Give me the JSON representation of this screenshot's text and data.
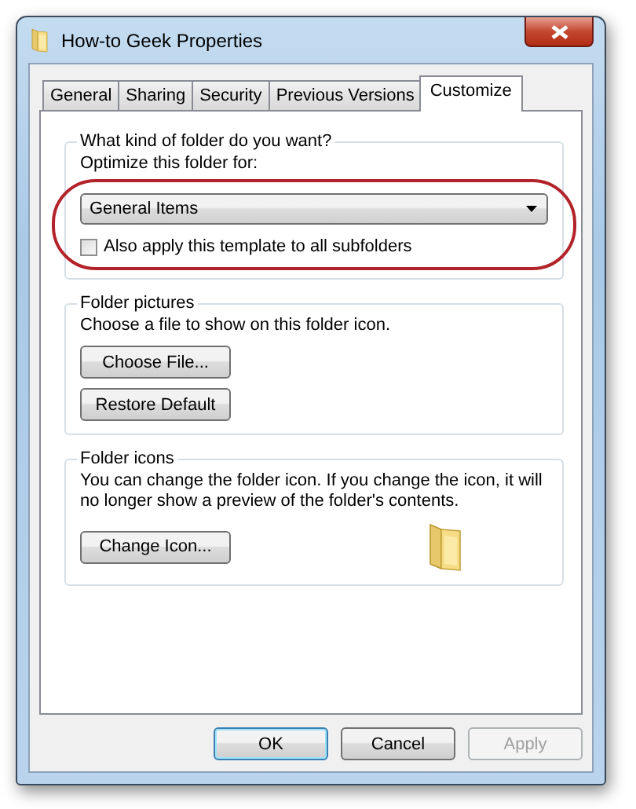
{
  "window": {
    "title": "How-to Geek Properties"
  },
  "tabs": [
    {
      "label": "General",
      "selected": false
    },
    {
      "label": "Sharing",
      "selected": false
    },
    {
      "label": "Security",
      "selected": false
    },
    {
      "label": "Previous Versions",
      "selected": false
    },
    {
      "label": "Customize",
      "selected": true
    }
  ],
  "groups": [
    {
      "legend": "What kind of folder do you want?",
      "items": [
        {
          "kind": "label",
          "text": "Optimize this folder for:"
        },
        {
          "kind": "dropdown",
          "value": "General Items"
        },
        {
          "kind": "checkbox",
          "text": "Also apply this template to all subfolders",
          "checked": false
        }
      ]
    },
    {
      "legend": "Folder pictures",
      "items": [
        {
          "kind": "label",
          "text": "Choose a file to show on this folder icon."
        },
        {
          "kind": "button",
          "text": "Choose File..."
        },
        {
          "kind": "button",
          "text": "Restore Default"
        }
      ]
    },
    {
      "legend": "Folder icons",
      "items": [
        {
          "kind": "label",
          "text": "You can change the folder icon. If you change the icon, it will no longer show a preview of the folder's contents."
        },
        {
          "kind": "button_with_preview",
          "text": "Change Icon..."
        }
      ]
    }
  ],
  "buttons": [
    {
      "label": "OK",
      "default": true,
      "disabled": false
    },
    {
      "label": "Cancel",
      "default": false,
      "disabled": false
    },
    {
      "label": "Apply",
      "default": false,
      "disabled": true
    }
  ]
}
